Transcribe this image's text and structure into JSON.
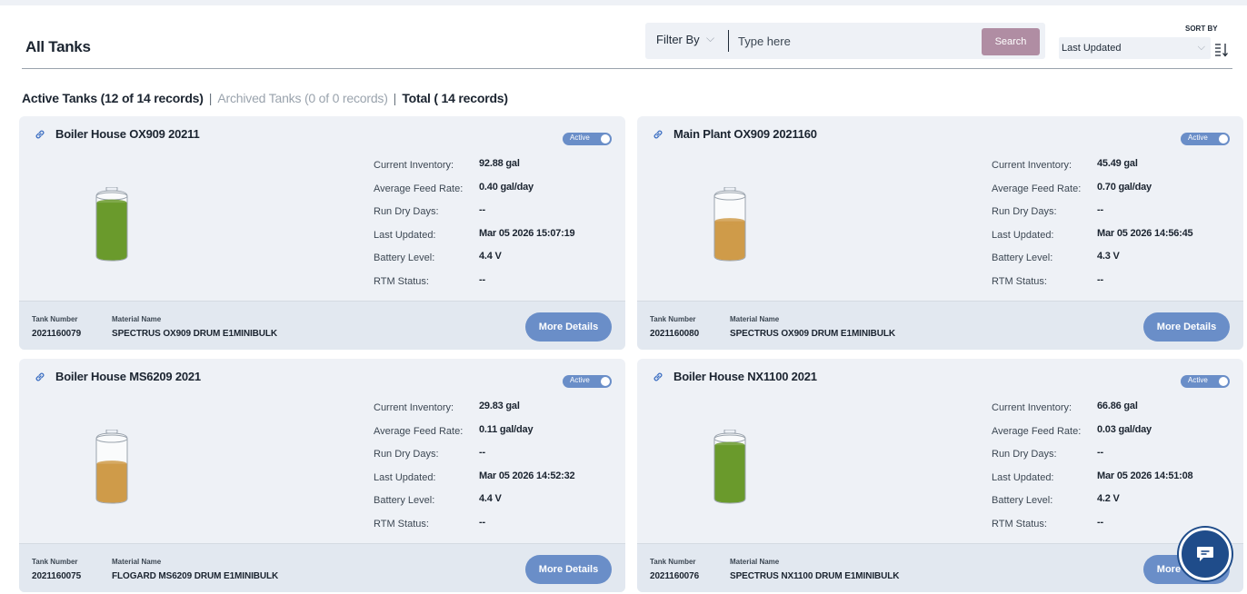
{
  "header": {
    "title": "All Tanks",
    "filter_label": "Filter By",
    "search_placeholder": "Type here",
    "search_button": "Search",
    "sort_by_label": "SORT BY",
    "sort_value": "Last Updated"
  },
  "tabs": {
    "active": "Active Tanks (12 of 14 records)",
    "archived": "Archived Tanks (0 of 0 records)",
    "total": "Total ( 14 records)",
    "separator": "|"
  },
  "labels": {
    "current_inventory": "Current Inventory:",
    "average_feed_rate": "Average Feed Rate:",
    "run_dry_days": "Run Dry Days:",
    "last_updated": "Last Updated:",
    "battery_level": "Battery Level:",
    "rtm_status": "RTM Status:",
    "tank_number": "Tank Number",
    "material_name": "Material Name",
    "more_details": "More Details",
    "active_badge": "Active"
  },
  "cards": [
    {
      "name": "Boiler House OX909 20211",
      "current_inventory": "92.88 gal",
      "average_feed_rate": "0.40 gal/day",
      "run_dry_days": "--",
      "last_updated": "Mar 05 2026 15:07:19",
      "battery_level": "4.4 V",
      "rtm_status": "--",
      "tank_number": "2021160079",
      "material_name": "SPECTRUS OX909 DRUM E1MINIBULK",
      "fill_level": 0.92,
      "fill_color": "#6a9a2c"
    },
    {
      "name": "Main Plant OX909 2021160",
      "current_inventory": "45.49 gal",
      "average_feed_rate": "0.70 gal/day",
      "run_dry_days": "--",
      "last_updated": "Mar 05 2026 14:56:45",
      "battery_level": "4.3 V",
      "rtm_status": "--",
      "tank_number": "2021160080",
      "material_name": "SPECTRUS OX909 DRUM E1MINIBULK",
      "fill_level": 0.6,
      "fill_color": "#cf9b49"
    },
    {
      "name": "Boiler House MS6209 2021",
      "current_inventory": "29.83 gal",
      "average_feed_rate": "0.11 gal/day",
      "run_dry_days": "--",
      "last_updated": "Mar 05 2026 14:52:32",
      "battery_level": "4.4 V",
      "rtm_status": "--",
      "tank_number": "2021160075",
      "material_name": "FLOGARD MS6209 DRUM E1MINIBULK",
      "fill_level": 0.6,
      "fill_color": "#cf9b49"
    },
    {
      "name": "Boiler House NX1100 2021",
      "current_inventory": "66.86 gal",
      "average_feed_rate": "0.03 gal/day",
      "run_dry_days": "--",
      "last_updated": "Mar 05 2026 14:51:08",
      "battery_level": "4.2 V",
      "rtm_status": "--",
      "tank_number": "2021160076",
      "material_name": "SPECTRUS NX1100 DRUM E1MINIBULK",
      "fill_level": 0.92,
      "fill_color": "#6a9a2c"
    }
  ],
  "colors": {
    "accent_blue": "#6a8ec8",
    "search_button": "#b08da3",
    "card_bg": "#eef1f6",
    "chat_widget": "#1f4c8a"
  }
}
